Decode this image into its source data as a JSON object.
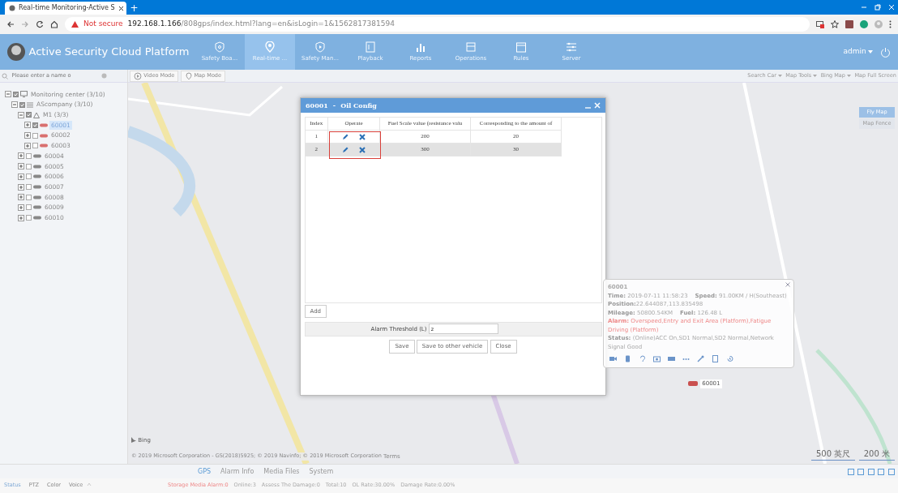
{
  "browser": {
    "tab_title": "Real-time Monitoring-Active S",
    "new_tab": "+",
    "security": "Not secure",
    "url_host": "192.168.1.166",
    "url_path": "/808gps/index.html?lang=en&isLogin=1&1562817381594"
  },
  "app": {
    "title": "Active Security Cloud Platform",
    "user": "admin",
    "nav": [
      {
        "label": "Safety Boa...",
        "selected": false
      },
      {
        "label": "Real-time ...",
        "selected": true
      },
      {
        "label": "Safety Man...",
        "selected": false
      },
      {
        "label": "Playback",
        "selected": false
      },
      {
        "label": "Reports",
        "selected": false
      },
      {
        "label": "Operations",
        "selected": false
      },
      {
        "label": "Rules",
        "selected": false
      },
      {
        "label": "Server",
        "selected": false
      }
    ]
  },
  "toolbar": {
    "search": {
      "placeholder": "Please enter a name o"
    },
    "modes": [
      "Video Mode",
      "Map Mode"
    ],
    "map_tools": [
      "Search Car",
      "Map Tools",
      "Bing Map",
      "Map Full Screen"
    ]
  },
  "tree": [
    {
      "label": "Monitoring center (3/10)",
      "kind": "center",
      "checked": true,
      "expanded": true,
      "children": [
        {
          "label": "AScompany (3/10)",
          "kind": "company",
          "checked": true,
          "expanded": true,
          "children": [
            {
              "label": "M1 (3/3)",
              "kind": "group",
              "checked": true,
              "expanded": true,
              "children": [
                {
                  "label": "60001",
                  "kind": "vehicle",
                  "checked": true,
                  "expanded": false,
                  "online": true,
                  "selected": true
                },
                {
                  "label": "60002",
                  "kind": "vehicle",
                  "checked": false,
                  "expanded": false,
                  "online": true,
                  "selected": false
                },
                {
                  "label": "60003",
                  "kind": "vehicle",
                  "checked": false,
                  "expanded": false,
                  "online": true,
                  "selected": false
                }
              ]
            },
            {
              "label": "60004",
              "kind": "vehicle",
              "checked": false,
              "expanded": false,
              "online": false,
              "selected": false
            },
            {
              "label": "60005",
              "kind": "vehicle",
              "checked": false,
              "expanded": false,
              "online": false,
              "selected": false
            },
            {
              "label": "60006",
              "kind": "vehicle",
              "checked": false,
              "expanded": false,
              "online": false,
              "selected": false
            },
            {
              "label": "60007",
              "kind": "vehicle",
              "checked": false,
              "expanded": false,
              "online": false,
              "selected": false
            },
            {
              "label": "60008",
              "kind": "vehicle",
              "checked": false,
              "expanded": false,
              "online": false,
              "selected": false
            },
            {
              "label": "60009",
              "kind": "vehicle",
              "checked": false,
              "expanded": false,
              "online": false,
              "selected": false
            },
            {
              "label": "60010",
              "kind": "vehicle",
              "checked": false,
              "expanded": false,
              "online": false,
              "selected": false
            }
          ]
        }
      ]
    }
  ],
  "map": {
    "side_buttons": [
      {
        "label": "Fly Map",
        "selected": true
      },
      {
        "label": "Map Fence",
        "selected": false
      }
    ],
    "logo": "Bing",
    "attribution": "© 2019 Microsoft Corporation - GS(2018)5925; © 2019 Navinfo; © 2019 Microsoft Corporation",
    "terms": "Terms",
    "scale": [
      "500 英尺",
      "200 米"
    ],
    "marker": "60001"
  },
  "dialog": {
    "vehicle": "60001",
    "separator": "-",
    "title": "Oil Config",
    "columns": [
      "Index",
      "Operate",
      "Fuel Scale value (resistance valu",
      "Corresponding to the amount of"
    ],
    "rows": [
      {
        "index": "1",
        "scale": "200",
        "amount": "20",
        "selected": false
      },
      {
        "index": "2",
        "scale": "300",
        "amount": "30",
        "selected": true
      }
    ],
    "add": "Add",
    "threshold_label": "Alarm Threshold (L)",
    "threshold_value": "2",
    "buttons": [
      "Save",
      "Save to other vehicle",
      "Close"
    ]
  },
  "popup": {
    "title": "60001",
    "lines": [
      {
        "text": "**Time:** 2019-07-11 11:58:23    **Speed:** 91.00KM / H(Southeast)",
        "alarm": false
      },
      {
        "text": "**Position:**22.644087,113.835498",
        "alarm": false
      },
      {
        "text": "**Mileage:** 50800.54KM    **Fuel:** 126.48 L",
        "alarm": false
      },
      {
        "text": "**Alarm:** Overspeed,Entry and Exit Area (Platform),Fatigue Driving (Platform)",
        "alarm": true
      },
      {
        "text": "**Status:** (Online)ACC On,SD1 Normal,SD2 Normal,Network Signal Good",
        "alarm": false
      }
    ]
  },
  "bottom_tabs": [
    {
      "label": "GPS",
      "selected": true
    },
    {
      "label": "Alarm Info",
      "selected": false
    },
    {
      "label": "Media Files",
      "selected": false
    },
    {
      "label": "System",
      "selected": false
    }
  ],
  "left_tabs": [
    {
      "label": "Status",
      "selected": true
    },
    {
      "label": "PTZ",
      "selected": false
    },
    {
      "label": "Color",
      "selected": false
    },
    {
      "label": "Voice",
      "selected": false
    }
  ],
  "status_bar": [
    {
      "text": "Storage Media Alarm:0",
      "alarm": true
    },
    {
      "text": "Online:3",
      "alarm": false
    },
    {
      "text": "Assess The Damage:0",
      "alarm": false
    },
    {
      "text": "Total:10",
      "alarm": false
    },
    {
      "text": "OL Rate:30.00%",
      "alarm": false
    },
    {
      "text": "Damage Rate:0.00%",
      "alarm": false
    }
  ]
}
